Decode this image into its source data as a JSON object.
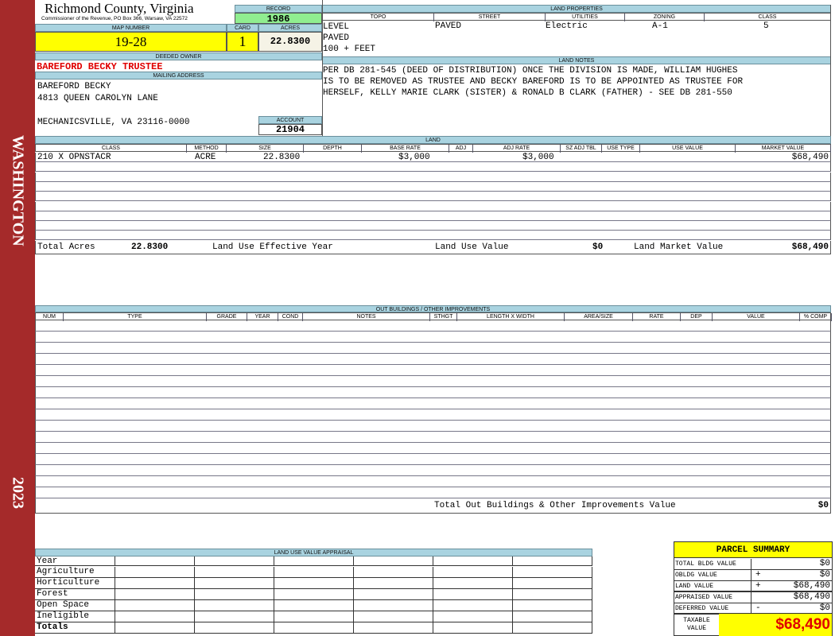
{
  "sidebar": {
    "name": "WASHINGTON",
    "year": "2023"
  },
  "header": {
    "county": "Richmond County, Virginia",
    "office": "Commissioner of the Revenue, PO Box 366, Warsaw, VA 22572"
  },
  "record": {
    "label": "RECORD",
    "value": "1986"
  },
  "map": {
    "label": "MAP NUMBER",
    "value": "19-28"
  },
  "card": {
    "label": "CARD",
    "value": "1"
  },
  "acres": {
    "label": "ACRES",
    "value": "22.8300"
  },
  "owner": {
    "label": "DEEDED OWNER",
    "value": "BAREFORD BECKY TRUSTEE"
  },
  "mailing": {
    "label": "MAILING ADDRESS",
    "lines": [
      "BAREFORD BECKY",
      "4813 QUEEN CAROLYN LANE",
      "",
      "MECHANICSVILLE, VA 23116-0000"
    ]
  },
  "account": {
    "label": "ACCOUNT",
    "value": "21904"
  },
  "land_properties": {
    "label": "LAND PROPERTIES",
    "columns": [
      "TOPO",
      "STREET",
      "UTILITIES",
      "ZONING",
      "CLASS"
    ],
    "topo": [
      "LEVEL",
      "PAVED",
      "100 + FEET"
    ],
    "street": "PAVED",
    "utilities": "Electric",
    "zoning": "A-1",
    "class": "5"
  },
  "land_notes": {
    "label": "LAND NOTES",
    "lines": [
      "PER DB 281-545 (DEED OF DISTRIBUTION) ONCE THE DIVISION IS MADE, WILLIAM HUGHES",
      "IS TO BE REMOVED AS TRUSTEE AND BECKY BAREFORD IS TO BE APPOINTED AS TRUSTEE FOR",
      "HERSELF, KELLY MARIE CLARK (SISTER) & RONALD B CLARK (FATHER) - SEE DB 281-550"
    ]
  },
  "land": {
    "label": "LAND",
    "columns": [
      "CLASS",
      "METHOD",
      "SIZE",
      "DEPTH",
      "BASE RATE",
      "ADJ",
      "ADJ RATE",
      "SZ ADJ TBL",
      "USE TYPE",
      "USE VALUE",
      "MARKET VALUE"
    ],
    "rows": [
      {
        "class": "210 X OPNSTACR",
        "method": "ACRE",
        "size": "22.8300",
        "base_rate": "$3,000",
        "adj_rate": "$3,000",
        "market_value": "$68,490"
      }
    ],
    "totals": {
      "total_acres_label": "Total Acres",
      "total_acres": "22.8300",
      "effective_year_label": "Land Use Effective Year",
      "use_value_label": "Land Use Value",
      "use_value": "$0",
      "market_value_label": "Land Market Value",
      "market_value": "$68,490"
    }
  },
  "outbuildings": {
    "label": "OUT BUILDINGS / OTHER IMPROVEMENTS",
    "columns": [
      "NUM",
      "TYPE",
      "GRADE",
      "YEAR",
      "COND",
      "NOTES",
      "STHGT",
      "LENGTH X WIDTH",
      "AREA/SIZE",
      "RATE",
      "DEP",
      "VALUE",
      "% COMP"
    ],
    "total_label": "Total Out Buildings & Other Improvements Value",
    "total": "$0"
  },
  "land_use_appraisal": {
    "label": "LAND USE VALUE APPRAISAL",
    "rows": [
      "Year",
      "Agriculture",
      "Horticulture",
      "Forest",
      "Open Space",
      "Ineligible",
      "Totals"
    ]
  },
  "parcel_summary": {
    "title": "PARCEL SUMMARY",
    "rows": [
      {
        "label": "TOTAL BLDG VALUE",
        "op": "",
        "value": "$0"
      },
      {
        "label": "OBLDG VALUE",
        "op": "+",
        "value": "$0"
      },
      {
        "label": "LAND VALUE",
        "op": "+",
        "value": "$68,490"
      },
      {
        "label": "APPRAISED VALUE",
        "op": "",
        "value": "$68,490"
      },
      {
        "label": "DEFERRED VALUE",
        "op": "-",
        "value": "$0"
      }
    ],
    "taxable_label": "TAXABLE VALUE",
    "taxable_value": "$68,490"
  },
  "colors": {
    "sidebar": "#a52a2a",
    "header_blue": "#a9d3e0",
    "highlight_yellow": "#ffff00",
    "record_green": "#90ee90",
    "owner_red": "#e00000"
  }
}
